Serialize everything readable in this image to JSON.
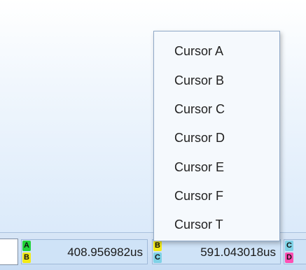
{
  "status_bar": {
    "cells": [
      {
        "top_letter": "A",
        "bottom_letter": "B",
        "value": "408.956982us"
      },
      {
        "top_letter": "B",
        "bottom_letter": "C",
        "value": "591.043018us"
      },
      {
        "top_letter": "C",
        "bottom_letter": "D",
        "value": ""
      }
    ]
  },
  "context_menu": {
    "items": [
      "Cursor A",
      "Cursor B",
      "Cursor C",
      "Cursor D",
      "Cursor E",
      "Cursor F",
      "Cursor T"
    ]
  },
  "colors": {
    "A": "#22d33a",
    "B": "#f2ea16",
    "C": "#7fd2e6",
    "D": "#ff4fb3"
  },
  "icons": {
    "badge": "cursor-pair-badge-icon"
  }
}
